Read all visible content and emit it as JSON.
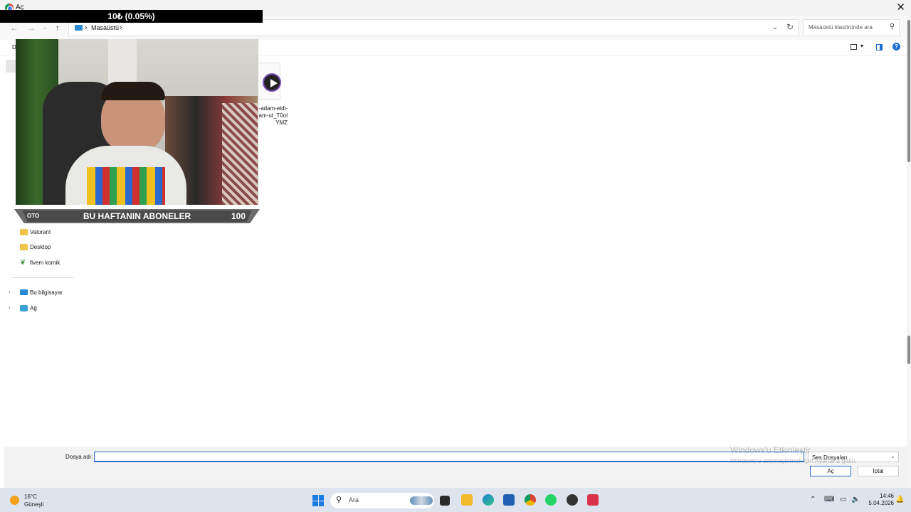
{
  "dialog": {
    "title": "Aç",
    "close_glyph": "✕",
    "breadcrumb": [
      "Masaüstü"
    ],
    "search_placeholder": "Masaüstü klasöründe ara",
    "toolbar_letter": "D"
  },
  "sidebar": {
    "items": [
      {
        "label": "Valorant",
        "icon": "folder-icon"
      },
      {
        "label": "Desktop",
        "icon": "folder-icon"
      },
      {
        "label": "fivem komik",
        "icon": "plant-icon"
      },
      {
        "label": "Bu bilgisayar",
        "icon": "pc-icon"
      },
      {
        "label": "Ağ",
        "icon": "network-icon"
      }
    ]
  },
  "file": {
    "name": "-ya-adam-eldi-adam-ut_T0olYMZ"
  },
  "bottom": {
    "filename_label": "Dosya adı:",
    "filename_value": "",
    "filetype_value": "Ses Dosyaları",
    "open_label": "Aç",
    "cancel_label": "İptal"
  },
  "watermark": {
    "title": "Windows'u Etkinleştir",
    "subtitle": "Windows'u etkinleştirmek için Ayarlar'a gidin."
  },
  "overlay": {
    "donation_text": "10₺ (0.05%)",
    "sub_banner_title": "BU HAFTANIN ABONELER",
    "sub_banner_count": "100",
    "sub_banner_left": "OTO"
  },
  "taskbar": {
    "weather_temp": "16°C",
    "weather_desc": "Güneşli",
    "search_label": "Ara",
    "clock_time": "14:46",
    "clock_date": "5.04.2026"
  },
  "colors": {
    "accent": "#2a6ed8",
    "folder": "#f2c24b",
    "taskbar": "#dde4ee"
  }
}
